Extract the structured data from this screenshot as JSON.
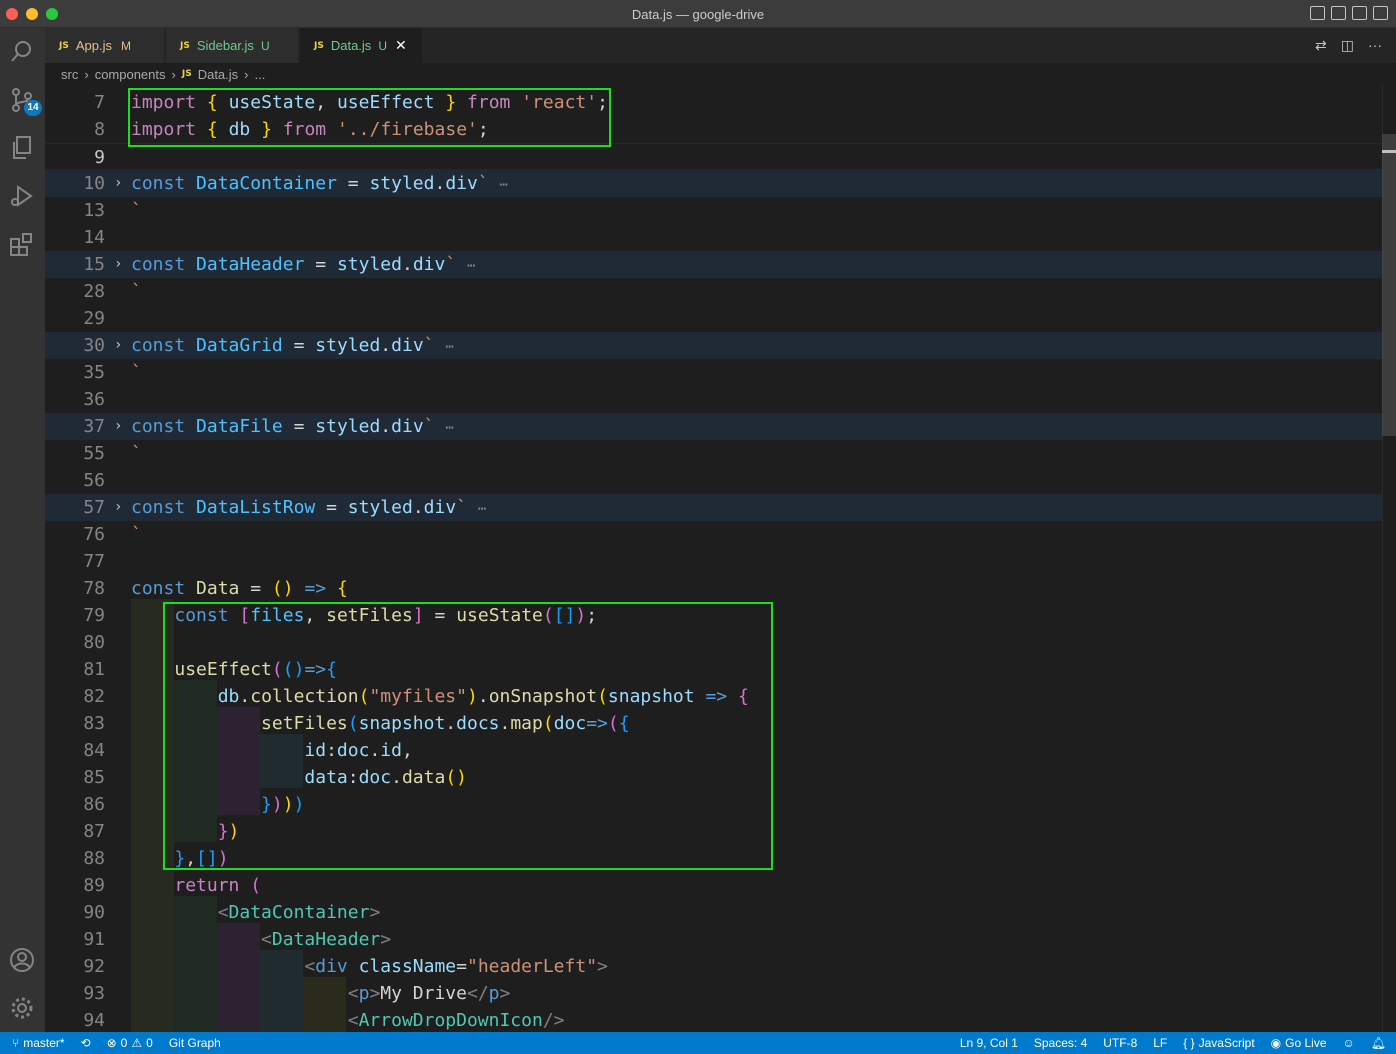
{
  "window": {
    "title": "Data.js — google-drive"
  },
  "activity": {
    "scm_badge": "14"
  },
  "tabs": [
    {
      "label": "App.js",
      "status": "M"
    },
    {
      "label": "Sidebar.js",
      "status": "U"
    },
    {
      "label": "Data.js",
      "status": "U",
      "close": "✕"
    }
  ],
  "breadcrumb": {
    "part1": "src",
    "part2": "components",
    "part3": "Data.js",
    "part4": "..."
  },
  "status": {
    "branch": "master*",
    "errors": "0",
    "warnings": "0",
    "git_graph": "Git Graph",
    "position": "Ln 9, Col 1",
    "spaces": "Spaces: 4",
    "encoding": "UTF-8",
    "eol": "LF",
    "language": "JavaScript",
    "golive": "Go Live"
  },
  "code": {
    "ln": [
      "7",
      "8",
      "9",
      "10",
      "13",
      "14",
      "15",
      "28",
      "29",
      "30",
      "35",
      "36",
      "37",
      "55",
      "56",
      "57",
      "76",
      "77",
      "78",
      "79",
      "80",
      "81",
      "82",
      "83",
      "84",
      "85",
      "86",
      "87",
      "88",
      "89",
      "90",
      "91",
      "92",
      "93",
      "94"
    ]
  }
}
